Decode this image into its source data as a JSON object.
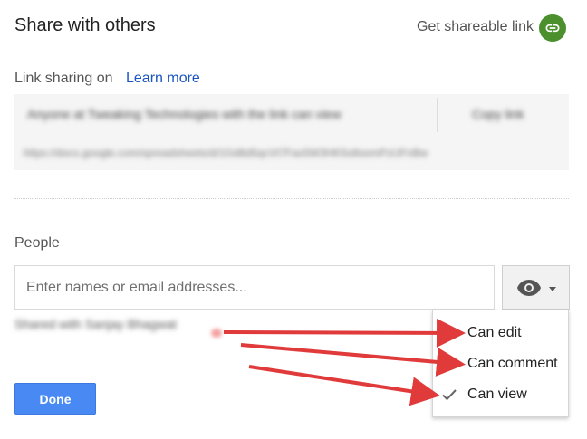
{
  "dialog": {
    "title": "Share with others",
    "get_link_label": "Get shareable link"
  },
  "link_sharing": {
    "status_label": "Link sharing on",
    "learn_more_label": "Learn more",
    "access_text": "Anyone at Tweaking Technologies with the link can view",
    "copy_label": "Copy link",
    "url": "https://docs.google.com/spreadsheets/d/1Gd8d5qcVt7Fax5W3HK5o8xemPzUFnBw"
  },
  "people": {
    "label": "People",
    "input_placeholder": "Enter names or email addresses...",
    "shared_with": "Shared with Sanjay Bhagwat",
    "permission_button_icon": "eye-icon"
  },
  "permission_menu": {
    "items": [
      {
        "label": "Can edit",
        "checked": false
      },
      {
        "label": "Can comment",
        "checked": false
      },
      {
        "label": "Can view",
        "checked": true
      }
    ]
  },
  "footer": {
    "done_label": "Done"
  },
  "colors": {
    "link_badge": "#4c8f2d",
    "link_text": "#1a55c0",
    "primary_button": "#4889f4",
    "annotation_arrow": "#e03a3a"
  }
}
